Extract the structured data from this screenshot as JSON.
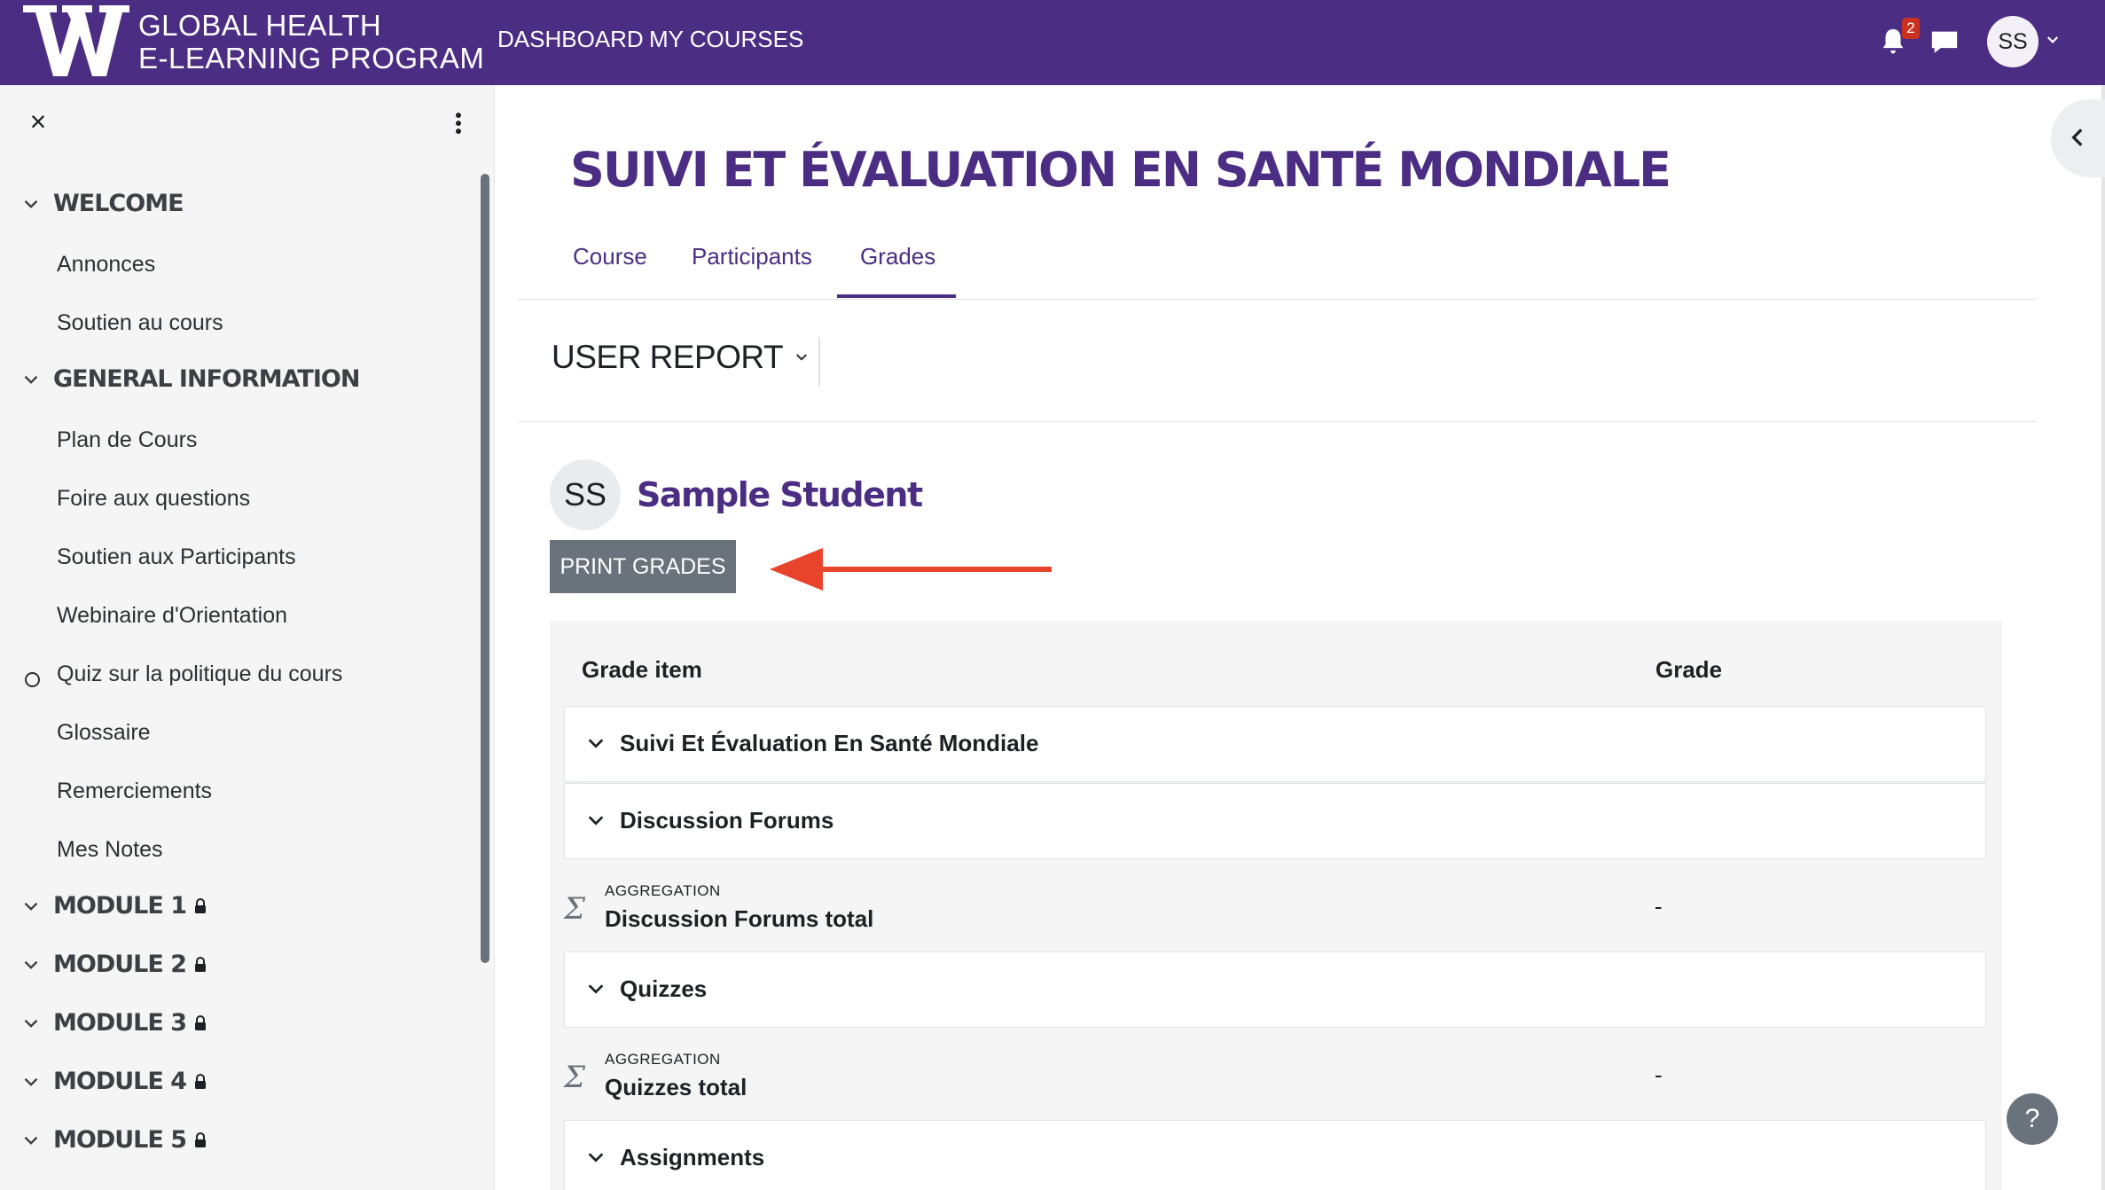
{
  "navbar": {
    "logo_line1": "GLOBAL HEALTH",
    "logo_line2": "E-LEARNING PROGRAM",
    "links": [
      "DASHBOARD",
      "MY COURSES"
    ],
    "notification_count": "2",
    "user_initials": "SS",
    "bg_color": "#4b2e83"
  },
  "drawer": {
    "close_glyph": "×",
    "sections": [
      {
        "title": "WELCOME",
        "items": [
          "Annonces",
          "Soutien au cours"
        ]
      },
      {
        "title": "GENERAL INFORMATION",
        "items": [
          "Plan de Cours",
          "Foire aux questions",
          "Soutien aux Participants",
          "Webinaire d'Orientation",
          "Quiz sur la politique du cours",
          "Glossaire",
          "Remerciements",
          "Mes Notes"
        ]
      },
      {
        "title": "MODULE 1",
        "locked": true
      },
      {
        "title": "MODULE 2",
        "locked": true
      },
      {
        "title": "MODULE 3",
        "locked": true
      },
      {
        "title": "MODULE 4",
        "locked": true
      },
      {
        "title": "MODULE 5",
        "locked": true
      }
    ]
  },
  "course": {
    "title": "SUIVI ET ÉVALUATION EN SANTÉ MONDIALE",
    "tabs": [
      "Course",
      "Participants",
      "Grades"
    ],
    "active_tab": "Grades"
  },
  "report": {
    "selector_label": "USER REPORT"
  },
  "user": {
    "initials": "SS",
    "name": "Sample Student",
    "print_button": "PRINT GRADES"
  },
  "grades_table": {
    "headers": {
      "item": "Grade item",
      "grade": "Grade"
    },
    "rows": [
      {
        "type": "category",
        "label": "Suivi Et Évaluation En Santé Mondiale"
      },
      {
        "type": "category",
        "label": "Discussion Forums"
      },
      {
        "type": "aggregation",
        "tag": "AGGREGATION",
        "label": "Discussion Forums total",
        "grade": "-"
      },
      {
        "type": "category",
        "label": "Quizzes"
      },
      {
        "type": "aggregation",
        "tag": "AGGREGATION",
        "label": "Quizzes total",
        "grade": "-"
      },
      {
        "type": "category",
        "label": "Assignments"
      }
    ]
  },
  "misc": {
    "help_glyph": "?",
    "sigma_glyph": "Σ",
    "annotation_arrow_color": "#e8442c"
  }
}
